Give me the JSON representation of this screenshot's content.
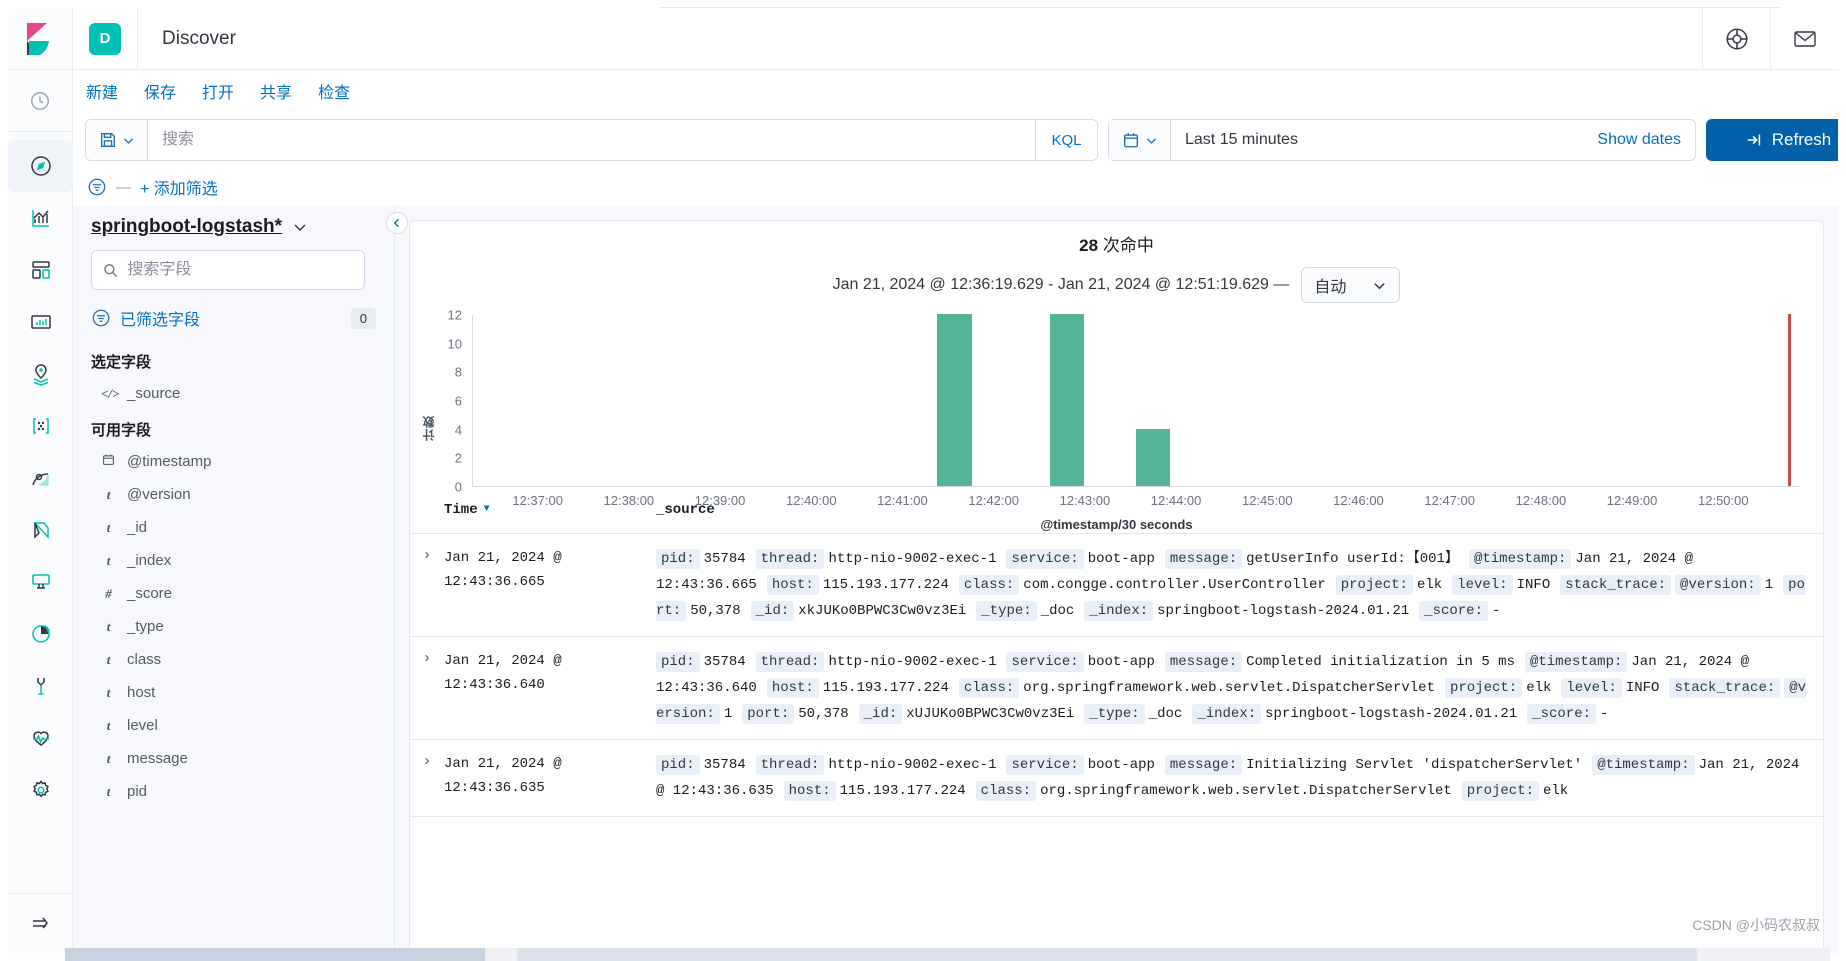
{
  "app": {
    "badge_letter": "D",
    "title": "Discover",
    "header_icons": [
      {
        "name": "help-icon",
        "glyph": "help"
      },
      {
        "name": "mail-icon",
        "glyph": "mail"
      }
    ]
  },
  "rail": {
    "items": [
      {
        "name": "recently-viewed",
        "icon": "clock-icon",
        "active": false
      },
      {
        "name": "discover",
        "icon": "compass-icon",
        "active": true
      },
      {
        "name": "visualize",
        "icon": "chart-icon",
        "active": false
      },
      {
        "name": "dashboard",
        "icon": "dashboard-icon",
        "active": false
      },
      {
        "name": "canvas",
        "icon": "canvas-icon",
        "active": false
      },
      {
        "name": "maps",
        "icon": "map-pin-icon",
        "active": false
      },
      {
        "name": "machine-learning",
        "icon": "ml-icon",
        "active": false
      },
      {
        "name": "graph",
        "icon": "graph-icon",
        "active": false
      },
      {
        "name": "uptime",
        "icon": "uptime-icon",
        "active": false
      },
      {
        "name": "apm",
        "icon": "apm-icon",
        "active": false
      },
      {
        "name": "metrics",
        "icon": "metrics-icon",
        "active": false
      },
      {
        "name": "dev-tools",
        "icon": "wrench-icon",
        "active": false
      },
      {
        "name": "monitoring",
        "icon": "heartbeat-icon",
        "active": false
      },
      {
        "name": "management",
        "icon": "gear-icon",
        "active": false
      }
    ],
    "collapse": {
      "name": "collapse-rail",
      "icon": "arrow-right-icon"
    }
  },
  "topnav": {
    "links": [
      {
        "label": "新建"
      },
      {
        "label": "保存"
      },
      {
        "label": "打开"
      },
      {
        "label": "共享"
      },
      {
        "label": "检查"
      }
    ]
  },
  "query_bar": {
    "saved_query_icon": "save-icon",
    "search_placeholder": "搜索",
    "search_value": "",
    "language": "KQL",
    "calendar_icon": "calendar-icon",
    "time_range": "Last 15 minutes",
    "show_dates": "Show dates",
    "refresh": "Refresh"
  },
  "filter_bar": {
    "filter_icon": "filter-icon",
    "dash": "—",
    "add_filter": "+ 添加筛选"
  },
  "sidebar": {
    "index_pattern": "springboot-logstash*",
    "field_search_placeholder": "搜索字段",
    "filtered_fields_label": "已筛选字段",
    "filtered_fields_count": "0",
    "selected_group_title": "选定字段",
    "selected_fields": [
      {
        "type": "</>",
        "label": "_source"
      }
    ],
    "available_group_title": "可用字段",
    "available_fields": [
      {
        "type": "date",
        "label": "@timestamp"
      },
      {
        "type": "t",
        "label": "@version"
      },
      {
        "type": "t",
        "label": "_id"
      },
      {
        "type": "t",
        "label": "_index"
      },
      {
        "type": "#",
        "label": "_score"
      },
      {
        "type": "t",
        "label": "_type"
      },
      {
        "type": "t",
        "label": "class"
      },
      {
        "type": "t",
        "label": "host"
      },
      {
        "type": "t",
        "label": "level"
      },
      {
        "type": "t",
        "label": "message"
      },
      {
        "type": "t",
        "label": "pid"
      }
    ]
  },
  "main": {
    "hits_count": "28",
    "hits_suffix": "次命中",
    "time_range_text": "Jan 21, 2024 @ 12:36:19.629 - Jan 21, 2024 @ 12:51:19.629 —",
    "interval_label": "自动"
  },
  "chart_data": {
    "type": "bar",
    "title": "28 次命中",
    "subtitle": "Jan 21, 2024 @ 12:36:19.629 - Jan 21, 2024 @ 12:51:19.629",
    "xlabel": "@timestamp/30 seconds",
    "ylabel": "计数",
    "ylim": [
      0,
      12
    ],
    "yticks": [
      0,
      2,
      4,
      6,
      8,
      10,
      12
    ],
    "bar_color": "#54b399",
    "now_marker_color": "#d3484d",
    "grid": false,
    "legend": "none",
    "x_tick_labels": [
      "12:37:00",
      "12:38:00",
      "12:39:00",
      "12:40:00",
      "12:41:00",
      "12:42:00",
      "12:43:00",
      "12:44:00",
      "12:45:00",
      "12:46:00",
      "12:47:00",
      "12:48:00",
      "12:49:00",
      "12:50:00"
    ],
    "categories": [
      "12:41:30",
      "12:42:30",
      "12:43:30"
    ],
    "values": [
      12,
      12,
      4
    ],
    "bars": [
      {
        "time": "12:41:30",
        "value": 12,
        "left_pct": 35.0,
        "width_pct": 2.6
      },
      {
        "time": "12:42:30",
        "value": 12,
        "left_pct": 43.5,
        "width_pct": 2.6
      },
      {
        "time": "12:43:30",
        "value": 4,
        "left_pct": 50.0,
        "width_pct": 2.6
      }
    ],
    "now_marker": {
      "left_pct": 99.2,
      "label": "now"
    }
  },
  "doc_table": {
    "columns": [
      {
        "label": "Time",
        "sorted": true,
        "sort_dir": "desc"
      },
      {
        "label": "_source"
      }
    ],
    "rows": [
      {
        "time": "Jan 21, 2024 @ 12:43:36.665",
        "fields": [
          {
            "key": "pid:",
            "value": "35784"
          },
          {
            "key": "thread:",
            "value": "http-nio-9002-exec-1"
          },
          {
            "key": "service:",
            "value": "boot-app"
          },
          {
            "key": "message:",
            "value": "getUserInfo userId:【001】"
          },
          {
            "key": "@timestamp:",
            "value": "Jan 21, 2024 @ 12:43:36.665"
          },
          {
            "key": "host:",
            "value": "115.193.177.224"
          },
          {
            "key": "class:",
            "value": "com.congge.controller.UserController"
          },
          {
            "key": "project:",
            "value": "elk"
          },
          {
            "key": "level:",
            "value": "INFO"
          },
          {
            "key": "stack_trace:",
            "value": ""
          },
          {
            "key": "@version:",
            "value": "1"
          },
          {
            "key": "port:",
            "value": "50,378"
          },
          {
            "key": "_id:",
            "value": "xkJUKo0BPWC3Cw0vz3Ei"
          },
          {
            "key": "_type:",
            "value": "_doc"
          },
          {
            "key": "_index:",
            "value": "springboot-logstash-2024.01.21"
          },
          {
            "key": "_score:",
            "value": "-"
          }
        ]
      },
      {
        "time": "Jan 21, 2024 @ 12:43:36.640",
        "fields": [
          {
            "key": "pid:",
            "value": "35784"
          },
          {
            "key": "thread:",
            "value": "http-nio-9002-exec-1"
          },
          {
            "key": "service:",
            "value": "boot-app"
          },
          {
            "key": "message:",
            "value": "Completed initialization in 5 ms"
          },
          {
            "key": "@timestamp:",
            "value": "Jan 21, 2024 @ 12:43:36.640"
          },
          {
            "key": "host:",
            "value": "115.193.177.224"
          },
          {
            "key": "class:",
            "value": "org.springframework.web.servlet.DispatcherServlet"
          },
          {
            "key": "project:",
            "value": "elk"
          },
          {
            "key": "level:",
            "value": "INFO"
          },
          {
            "key": "stack_trace:",
            "value": ""
          },
          {
            "key": "@version:",
            "value": "1"
          },
          {
            "key": "port:",
            "value": "50,378"
          },
          {
            "key": "_id:",
            "value": "xUJUKo0BPWC3Cw0vz3Ei"
          },
          {
            "key": "_type:",
            "value": "_doc"
          },
          {
            "key": "_index:",
            "value": "springboot-logstash-2024.01.21"
          },
          {
            "key": "_score:",
            "value": "-"
          }
        ]
      },
      {
        "time": "Jan 21, 2024 @ 12:43:36.635",
        "fields": [
          {
            "key": "pid:",
            "value": "35784"
          },
          {
            "key": "thread:",
            "value": "http-nio-9002-exec-1"
          },
          {
            "key": "service:",
            "value": "boot-app"
          },
          {
            "key": "message:",
            "value": "Initializing Servlet 'dispatcherServlet'"
          },
          {
            "key": "@timestamp:",
            "value": "Jan 21, 2024 @ 12:43:36.635"
          },
          {
            "key": "host:",
            "value": "115.193.177.224"
          },
          {
            "key": "class:",
            "value": "org.springframework.web.servlet.DispatcherServlet"
          },
          {
            "key": "project:",
            "value": "elk"
          }
        ]
      }
    ]
  },
  "watermark": "CSDN @小码农叔叔"
}
